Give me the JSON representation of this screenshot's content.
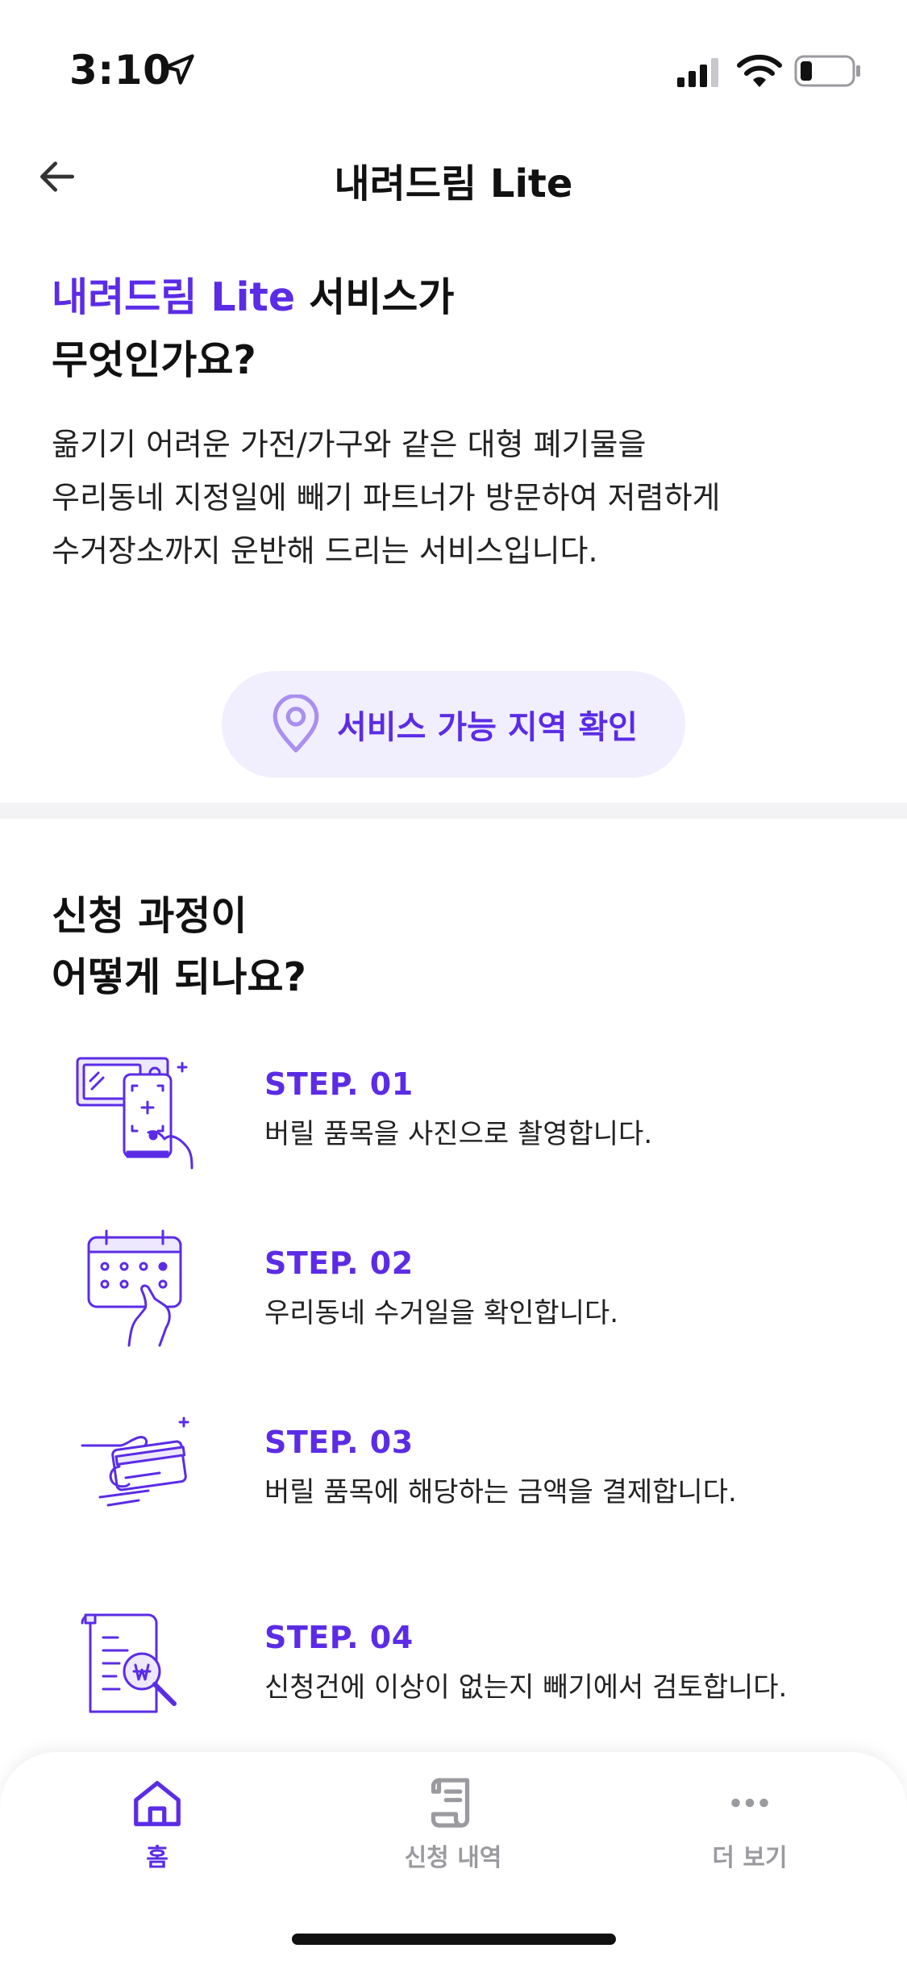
{
  "status_bar": {
    "time": "3:10",
    "icons": [
      "location-arrow-icon",
      "signal-icon",
      "wifi-icon",
      "battery-icon"
    ]
  },
  "header": {
    "title": "내려드림 Lite",
    "back_icon": "back-arrow-icon"
  },
  "intro": {
    "title_accent": "내려드림 Lite",
    "title_rest": " 서비스가",
    "title_line2": "무엇인가요?",
    "desc_line1": "옮기기 어려운 가전/가구와 같은 대형 폐기물을",
    "desc_line2": "우리동네 지정일에 빼기 파트너가 방문하여 저렴하게",
    "desc_line3": "수거장소까지 운반해 드리는 서비스입니다.",
    "region_button": "서비스 가능 지역 확인"
  },
  "process": {
    "title_line1": "신청 과정이",
    "title_line2": "어떻게 되나요?",
    "steps": [
      {
        "num": "STEP. 01",
        "text": "버릴 품목을 사진으로 촬영합니다.",
        "icon": "phone-camera-icon"
      },
      {
        "num": "STEP. 02",
        "text": "우리동네 수거일을 확인합니다.",
        "icon": "calendar-icon"
      },
      {
        "num": "STEP. 03",
        "text": "버릴 품목에 해당하는 금액을 결제합니다.",
        "icon": "card-payment-icon"
      },
      {
        "num": "STEP. 04",
        "text": "신청건에 이상이 없는지 빼기에서 검토합니다.",
        "icon": "document-review-icon"
      }
    ]
  },
  "tabbar": {
    "items": [
      {
        "label": "홈",
        "icon": "home-icon",
        "active": true
      },
      {
        "label": "신청 내역",
        "icon": "receipt-icon",
        "active": false
      },
      {
        "label": "더 보기",
        "icon": "more-dots-icon",
        "active": false
      }
    ]
  },
  "colors": {
    "accent": "#5b2ce6",
    "accent_bg": "#f1eefe",
    "inactive": "#9a9a9f"
  }
}
